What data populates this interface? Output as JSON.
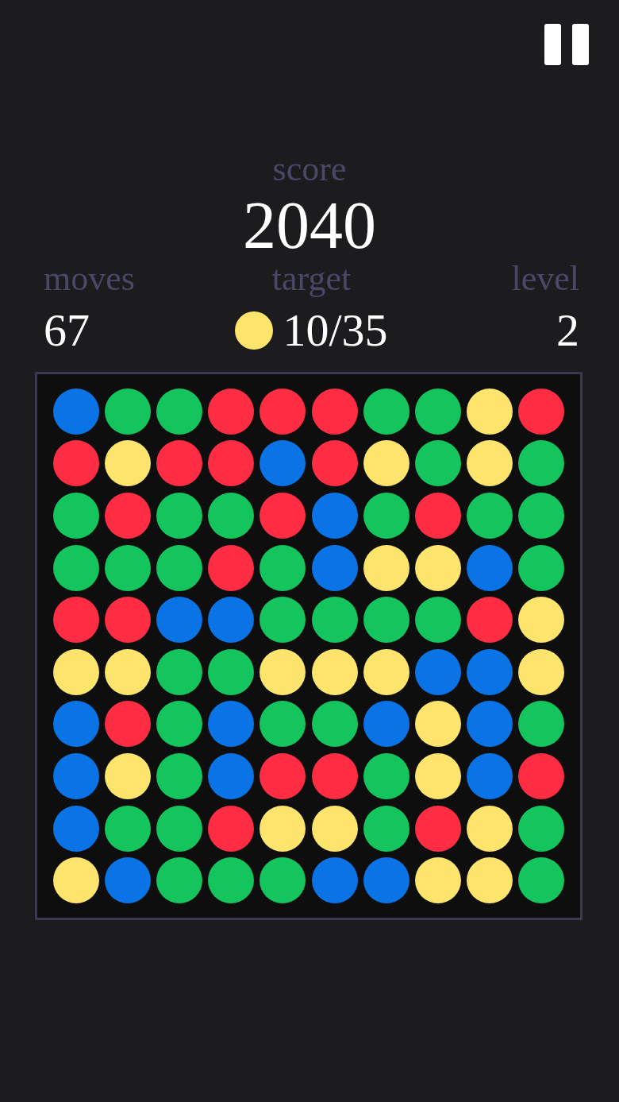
{
  "score": {
    "label": "score",
    "value": "2040"
  },
  "stats": [
    {
      "kind": "text",
      "label": "moves",
      "value": "67"
    },
    {
      "kind": "target",
      "label": "target",
      "value": "10/35",
      "color": "#fde46c"
    },
    {
      "kind": "text",
      "label": "level",
      "value": "2"
    }
  ],
  "board": {
    "rows": [
      [
        {
          "color": "#0a74e6"
        },
        {
          "color": "#14c45c"
        },
        {
          "color": "#14c45c"
        },
        {
          "color": "#ff2d44"
        },
        {
          "color": "#ff2d44"
        },
        {
          "color": "#ff2d44"
        },
        {
          "color": "#14c45c"
        },
        {
          "color": "#14c45c"
        },
        {
          "color": "#fde46c"
        },
        {
          "color": "#ff2d44"
        }
      ],
      [
        {
          "color": "#ff2d44"
        },
        {
          "color": "#fde46c"
        },
        {
          "color": "#ff2d44"
        },
        {
          "color": "#ff2d44"
        },
        {
          "color": "#0a74e6"
        },
        {
          "color": "#ff2d44"
        },
        {
          "color": "#fde46c"
        },
        {
          "color": "#14c45c"
        },
        {
          "color": "#fde46c"
        },
        {
          "color": "#14c45c"
        }
      ],
      [
        {
          "color": "#14c45c"
        },
        {
          "color": "#ff2d44"
        },
        {
          "color": "#14c45c"
        },
        {
          "color": "#14c45c"
        },
        {
          "color": "#ff2d44"
        },
        {
          "color": "#0a74e6"
        },
        {
          "color": "#14c45c"
        },
        {
          "color": "#ff2d44"
        },
        {
          "color": "#14c45c"
        },
        {
          "color": "#14c45c"
        }
      ],
      [
        {
          "color": "#14c45c"
        },
        {
          "color": "#14c45c"
        },
        {
          "color": "#14c45c"
        },
        {
          "color": "#ff2d44"
        },
        {
          "color": "#14c45c"
        },
        {
          "color": "#0a74e6"
        },
        {
          "color": "#fde46c"
        },
        {
          "color": "#fde46c"
        },
        {
          "color": "#0a74e6"
        },
        {
          "color": "#14c45c"
        }
      ],
      [
        {
          "color": "#ff2d44"
        },
        {
          "color": "#ff2d44"
        },
        {
          "color": "#0a74e6"
        },
        {
          "color": "#0a74e6"
        },
        {
          "color": "#14c45c"
        },
        {
          "color": "#14c45c"
        },
        {
          "color": "#14c45c"
        },
        {
          "color": "#14c45c"
        },
        {
          "color": "#ff2d44"
        },
        {
          "color": "#fde46c"
        }
      ],
      [
        {
          "color": "#fde46c"
        },
        {
          "color": "#fde46c"
        },
        {
          "color": "#14c45c"
        },
        {
          "color": "#14c45c"
        },
        {
          "color": "#fde46c"
        },
        {
          "color": "#fde46c"
        },
        {
          "color": "#fde46c"
        },
        {
          "color": "#0a74e6"
        },
        {
          "color": "#0a74e6"
        },
        {
          "color": "#fde46c"
        }
      ],
      [
        {
          "color": "#0a74e6"
        },
        {
          "color": "#ff2d44"
        },
        {
          "color": "#14c45c"
        },
        {
          "color": "#0a74e6"
        },
        {
          "color": "#14c45c"
        },
        {
          "color": "#14c45c"
        },
        {
          "color": "#0a74e6"
        },
        {
          "color": "#fde46c"
        },
        {
          "color": "#0a74e6"
        },
        {
          "color": "#14c45c"
        }
      ],
      [
        {
          "color": "#0a74e6"
        },
        {
          "color": "#fde46c"
        },
        {
          "color": "#14c45c"
        },
        {
          "color": "#0a74e6"
        },
        {
          "color": "#ff2d44"
        },
        {
          "color": "#ff2d44"
        },
        {
          "color": "#14c45c"
        },
        {
          "color": "#fde46c"
        },
        {
          "color": "#0a74e6"
        },
        {
          "color": "#ff2d44"
        }
      ],
      [
        {
          "color": "#0a74e6"
        },
        {
          "color": "#14c45c"
        },
        {
          "color": "#14c45c"
        },
        {
          "color": "#ff2d44"
        },
        {
          "color": "#fde46c"
        },
        {
          "color": "#fde46c"
        },
        {
          "color": "#14c45c"
        },
        {
          "color": "#ff2d44"
        },
        {
          "color": "#fde46c"
        },
        {
          "color": "#14c45c"
        }
      ],
      [
        {
          "color": "#fde46c"
        },
        {
          "color": "#0a74e6"
        },
        {
          "color": "#14c45c"
        },
        {
          "color": "#14c45c"
        },
        {
          "color": "#14c45c"
        },
        {
          "color": "#0a74e6"
        },
        {
          "color": "#0a74e6"
        },
        {
          "color": "#fde46c"
        },
        {
          "color": "#fde46c"
        },
        {
          "color": "#14c45c"
        }
      ]
    ]
  }
}
